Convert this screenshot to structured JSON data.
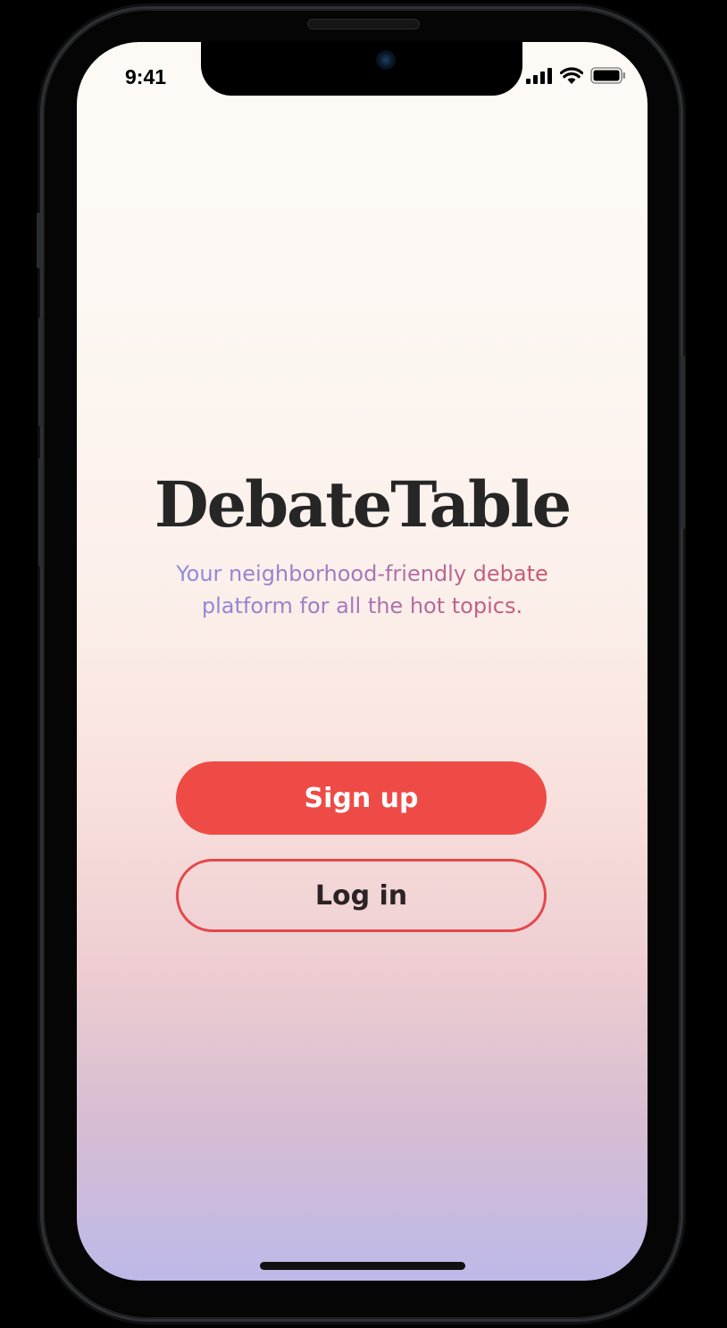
{
  "status_bar": {
    "time": "9:41",
    "icons": [
      "cellular-signal-icon",
      "wifi-icon",
      "battery-icon"
    ]
  },
  "app": {
    "title": "DebateTable",
    "tagline": "Your neighborhood-friendly debate platform for all the hot topics."
  },
  "actions": {
    "signup_label": "Sign up",
    "login_label": "Log in"
  },
  "colors": {
    "accent": "#ee4b46",
    "title": "#262626",
    "tagline_start": "#8a8fe0",
    "tagline_end": "#d2505e"
  }
}
